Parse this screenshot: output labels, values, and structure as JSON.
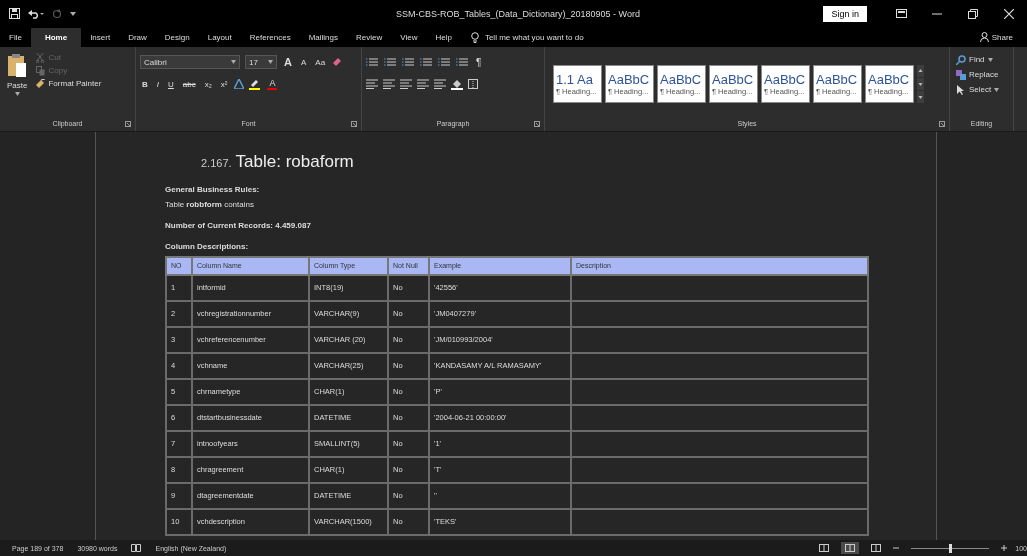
{
  "title_bar": {
    "title": "SSM-CBS-ROB_Tables_(Data_Dictionary)_20180905 - Word",
    "sign_in": "Sign in",
    "redo": {
      "disabled": true
    }
  },
  "tabs": [
    {
      "label": "File",
      "selected": false
    },
    {
      "label": "Home",
      "selected": true
    },
    {
      "label": "Insert",
      "selected": false
    },
    {
      "label": "Draw",
      "selected": false
    },
    {
      "label": "Design",
      "selected": false
    },
    {
      "label": "Layout",
      "selected": false
    },
    {
      "label": "References",
      "selected": false
    },
    {
      "label": "Mailings",
      "selected": false
    },
    {
      "label": "Review",
      "selected": false
    },
    {
      "label": "View",
      "selected": false
    },
    {
      "label": "Help",
      "selected": false
    }
  ],
  "tell_me": {
    "placeholder": "Tell me what you want to do"
  },
  "share": "Share",
  "ribbon": {
    "clipboard": {
      "label": "Clipboard",
      "paste": "Paste",
      "buttons": [
        {
          "label": "Cut",
          "disabled": true
        },
        {
          "label": "Copy",
          "disabled": true
        },
        {
          "label": "Format Painter",
          "disabled": false
        }
      ]
    },
    "font": {
      "label": "Font",
      "font_name": "Calibri",
      "font_size": "17",
      "grow": "A",
      "shrink": "A",
      "change_case": "Aa",
      "format_buttons": [
        "B",
        "I",
        "U",
        "abc",
        "x₂",
        "x²"
      ],
      "font_color": "A"
    },
    "paragraph": {
      "label": "Paragraph",
      "pilcrow": "¶"
    },
    "styles": {
      "label": "Styles",
      "items": [
        {
          "preview": "1.1 Aa",
          "caption": "¶ Heading..."
        },
        {
          "preview": "AaBbC",
          "caption": "¶ Heading..."
        },
        {
          "preview": "AaBbC",
          "caption": "¶ Heading..."
        },
        {
          "preview": "AaBbC",
          "caption": "¶ Heading..."
        },
        {
          "preview": "AaBbC",
          "caption": "¶ Heading..."
        },
        {
          "preview": "AaBbC",
          "caption": "¶ Heading..."
        },
        {
          "preview": "AaBbC",
          "caption": "¶ Heading..."
        }
      ]
    },
    "editing": {
      "label": "Editing",
      "buttons": [
        {
          "label": "Find",
          "has_menu": true
        },
        {
          "label": "Replace",
          "has_menu": false
        },
        {
          "label": "Select",
          "has_menu": true
        }
      ]
    }
  },
  "document": {
    "section_number": "2.167.",
    "title": "Table: robaform",
    "paragraphs": [
      {
        "kind": "heading",
        "text": "General Business Rules:"
      },
      {
        "kind": "body",
        "text": "Table **robbform** contains"
      },
      {
        "kind": "heading",
        "text": "Number of Current Records: 4.459.087"
      },
      {
        "kind": "heading",
        "text": "Column Descriptions:"
      }
    ],
    "table": {
      "columns": [
        "NO",
        "Column Name",
        "Column Type",
        "Not Null",
        "Example",
        "Description"
      ],
      "rows": [
        [
          "1",
          "intformid",
          "INT8(19)",
          "No",
          "'42556'",
          ""
        ],
        [
          "2",
          "vchregistrationnumber",
          "VARCHAR(9)",
          "No",
          "'JM0407279'",
          ""
        ],
        [
          "3",
          "vchreferencenumber",
          "VARCHAR (20)",
          "No",
          "'JM/010993/2004'",
          ""
        ],
        [
          "4",
          "vchname",
          "VARCHAR(25)",
          "No",
          "'KANDASAMY A/L RAMASAMY'",
          ""
        ],
        [
          "5",
          "chrnametype",
          "CHAR(1)",
          "No",
          "'P'",
          ""
        ],
        [
          "6",
          "dtstartbusinessdate",
          "DATETIME",
          "No",
          "'2004-06-21 00:00:00'",
          ""
        ],
        [
          "7",
          "intnoofyears",
          "SMALLINT(5)",
          "No",
          "'1'",
          ""
        ],
        [
          "8",
          "chragreement",
          "CHAR(1)",
          "No",
          "'T'",
          ""
        ],
        [
          "9",
          "dtagreementdate",
          "DATETIME",
          "No",
          "''",
          ""
        ],
        [
          "10",
          "vchdescription",
          "VARCHAR(1500)",
          "No",
          "'TEKS'",
          ""
        ]
      ]
    }
  },
  "status_bar": {
    "page": "Page 189 of 378",
    "words": "30980 words",
    "language": "English (New Zealand)",
    "views": [
      {
        "selected": false
      },
      {
        "selected": true
      },
      {
        "selected": false
      }
    ],
    "zoom_slider": {
      "level": 0.5
    },
    "zoom": "100"
  }
}
